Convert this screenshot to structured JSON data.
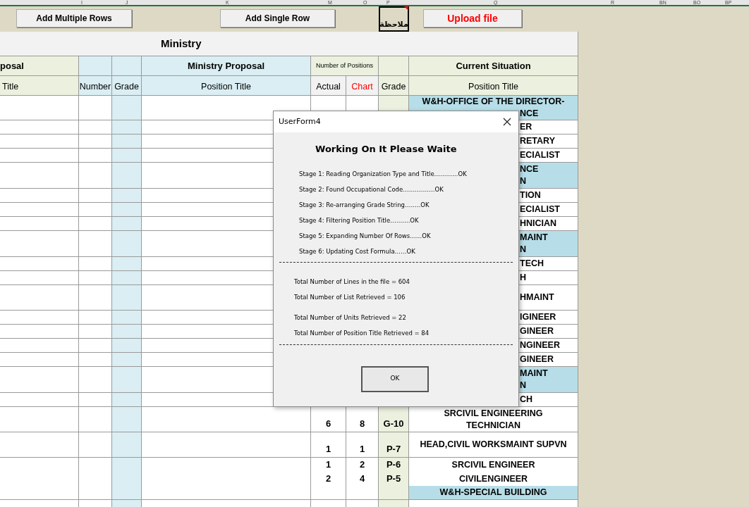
{
  "column_headers": [
    {
      "label": "I"
    },
    {
      "label": "J"
    },
    {
      "label": "K"
    },
    {
      "label": "M"
    },
    {
      "label": "O"
    },
    {
      "label": "P"
    },
    {
      "label": "Q"
    },
    {
      "label": "R"
    },
    {
      "label": "BN"
    },
    {
      "label": "BO"
    },
    {
      "label": "BP"
    }
  ],
  "toolbar": {
    "add_multiple": "Add Multiple Rows",
    "add_single": "Add Single Row",
    "note_cell": "ملاحظة",
    "upload": "Upload file"
  },
  "sheet_title": "Ministry",
  "group_headers": {
    "proposal": "posal",
    "ministry_proposal": "Ministry Proposal",
    "number_of_positions": "Number of Positions",
    "current_situation": "Current Situation"
  },
  "column_labels": [
    {
      "label": "Title",
      "kind": "plain"
    },
    {
      "label": "Number",
      "kind": "plain"
    },
    {
      "label": "Grade",
      "kind": "plain"
    },
    {
      "label": "Position Title",
      "kind": "plain"
    },
    {
      "label": "Actual",
      "kind": "plain"
    },
    {
      "label": "Chart",
      "kind": "highlighted"
    },
    {
      "label": "Grade",
      "kind": "plain"
    },
    {
      "label": "Position Title",
      "kind": "plain"
    }
  ],
  "rows": [
    {
      "kind": "section",
      "lines": [
        {
          "text": "W&H-OFFICE OF THE DIRECTOR-",
          "partly_hidden": false
        },
        {
          "text": "NCE",
          "partly_hidden": true
        }
      ]
    },
    {
      "kind": "position",
      "lines": [
        {
          "text": "ER",
          "partly_hidden": true
        }
      ]
    },
    {
      "kind": "position",
      "lines": [
        {
          "text": "RETARY",
          "partly_hidden": true
        }
      ]
    },
    {
      "kind": "position",
      "lines": [
        {
          "text": "ECIALIST",
          "partly_hidden": true
        }
      ]
    },
    {
      "kind": "section",
      "lines": [
        {
          "text": "NCE",
          "partly_hidden": true
        },
        {
          "text": "N",
          "partly_hidden": true
        }
      ]
    },
    {
      "kind": "position",
      "lines": [
        {
          "text": "TION",
          "partly_hidden": true
        }
      ]
    },
    {
      "kind": "position",
      "lines": [
        {
          "text": "ECIALIST",
          "partly_hidden": true
        }
      ]
    },
    {
      "kind": "position",
      "lines": [
        {
          "text": "HNICIAN",
          "partly_hidden": true
        }
      ]
    },
    {
      "kind": "section",
      "lines": [
        {
          "text": "MAINT",
          "partly_hidden": true
        },
        {
          "text": "N",
          "partly_hidden": true
        }
      ]
    },
    {
      "kind": "position",
      "lines": [
        {
          "text": "TECH",
          "partly_hidden": true
        }
      ]
    },
    {
      "kind": "position",
      "lines": [
        {
          "text": "H",
          "partly_hidden": true
        }
      ]
    },
    {
      "kind": "position",
      "lines": [
        {
          "text": "HMAINT",
          "partly_hidden": true
        }
      ]
    },
    {
      "kind": "position",
      "lines": [
        {
          "text": "IGINEER",
          "partly_hidden": true
        }
      ]
    },
    {
      "kind": "position",
      "lines": [
        {
          "text": "GINEER",
          "partly_hidden": true
        }
      ]
    },
    {
      "kind": "position",
      "lines": [
        {
          "text": "NGINEER",
          "partly_hidden": true
        }
      ]
    },
    {
      "kind": "position",
      "lines": [
        {
          "text": "GINEER",
          "partly_hidden": true
        }
      ]
    },
    {
      "kind": "section",
      "lines": [
        {
          "text": "MAINT",
          "partly_hidden": true
        },
        {
          "text": "N",
          "partly_hidden": true
        }
      ]
    },
    {
      "kind": "position",
      "lines": [
        {
          "text": "CH",
          "partly_hidden": true
        }
      ]
    },
    {
      "kind": "position",
      "actual": "6",
      "chart": "8",
      "grade": "G-10",
      "lines": [
        {
          "text": "SRCIVIL  ENGINEERING",
          "partly_hidden": false
        },
        {
          "text": "TECHNICIAN",
          "partly_hidden": false
        }
      ]
    },
    {
      "kind": "position",
      "actual": "1",
      "chart": "1",
      "grade": "P-7",
      "lines": [
        {
          "text": "HEAD,CIVIL  WORKSMAINT  SUPVN",
          "partly_hidden": false
        }
      ]
    },
    {
      "kind": "position",
      "actual": "1",
      "chart": "2",
      "grade": "P-6",
      "lines": [
        {
          "text": "SRCIVIL  ENGINEER",
          "partly_hidden": false
        }
      ]
    },
    {
      "kind": "position",
      "actual": "2",
      "chart": "4",
      "grade": "P-5",
      "lines": [
        {
          "text": "CIVILENGINEER",
          "partly_hidden": false
        }
      ]
    },
    {
      "kind": "section",
      "lines": [
        {
          "text": "W&H-SPECIAL BUILDING",
          "partly_hidden": false
        }
      ]
    }
  ],
  "dialog": {
    "title": "UserForm4",
    "heading": "Working On It Please Waite",
    "stages": [
      "Stage 1: Reading Organization Type and Title…………OK",
      "Stage 2: Found Occupational Code…………….OK",
      "Stage 3: Re-arranging Grade String……..OK",
      "Stage 4: Filtering Position Title……….OK",
      "Stage 5: Expanding Number Of Rows……OK",
      "Stage 6: Updating Cost Formula……OK"
    ],
    "totals": [
      "Total Number of Lines in the file = 604",
      "Total Number of List Retrieved = 106",
      "Total Number of Units Retrieved = 22",
      "Total Number of Position Title Retrieved = 84"
    ],
    "ok": "OK"
  }
}
